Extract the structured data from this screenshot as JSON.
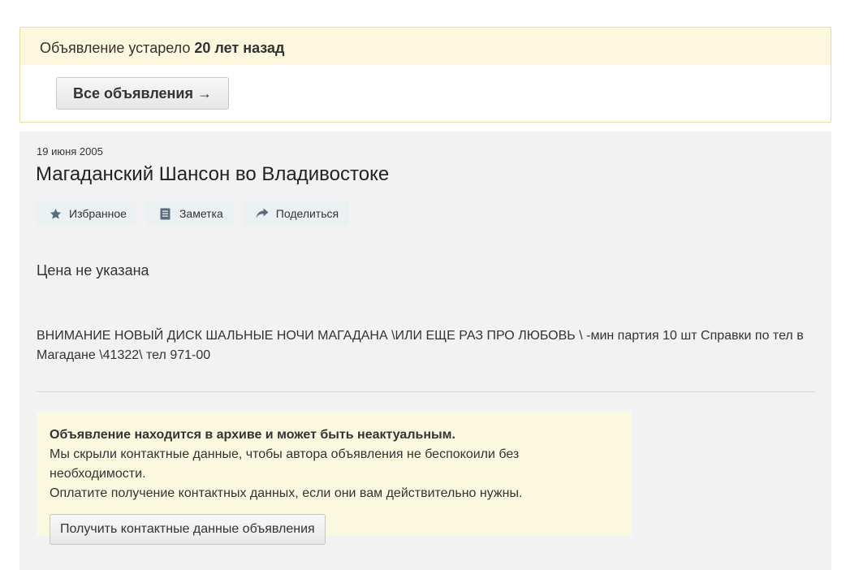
{
  "banner": {
    "outdated_prefix": "Объявление устарело",
    "outdated_age": "20 лет назад",
    "all_ads_button": "Все объявления →"
  },
  "ad": {
    "date": "19 июня 2005",
    "title": "Магаданский Шансон во Владивостоке",
    "actions": [
      {
        "label": "Избранное",
        "icon": "star-icon"
      },
      {
        "label": "Заметка",
        "icon": "note-icon"
      },
      {
        "label": "Поделиться",
        "icon": "share-icon"
      }
    ],
    "price": "Цена не указана",
    "description": "ВНИМАНИЕ НОВЫЙ ДИСК ШАЛЬНЫЕ НОЧИ МАГАДАНА \\ИЛИ ЕЩЕ РАЗ ПРО ЛЮБОВЬ \\ -мин партия 10 шт Справки по тел в Магадане \\41322\\ тел 971-00"
  },
  "archive_notice": {
    "heading": "Объявление находится в архиве и может быть неактуальным.",
    "line1": "Мы скрыли контактные данные, чтобы автора объявления не беспокоили без необходимости.",
    "line2": "Оплатите получение контактных данных, если они вам действительно нужны.",
    "button": "Получить контактные данные объявления"
  },
  "colors": {
    "banner_bg": "#fcf7dd",
    "card_bg": "#f2f2f2",
    "action_bg": "#ebf0f3",
    "icon_color": "#5a6c7d",
    "archive_bg": "#fbf8e0"
  }
}
